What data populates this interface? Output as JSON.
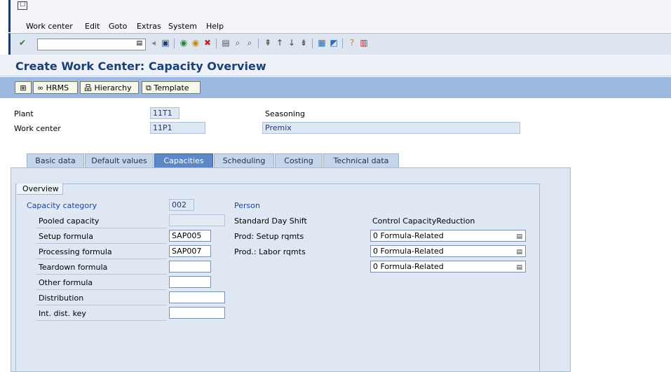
{
  "menu": {
    "items": [
      "Work center",
      "Edit",
      "Goto",
      "Extras",
      "System",
      "Help"
    ]
  },
  "toolbar": {
    "command_value": "",
    "icons": [
      "enter-icon",
      "save-icon",
      "back-icon",
      "exit-icon",
      "cancel-icon",
      "print-icon",
      "find-icon",
      "find-next-icon",
      "first-page-icon",
      "prev-page-icon",
      "next-page-icon",
      "last-page-icon",
      "create-session-icon",
      "shortcut-icon",
      "help-icon",
      "customize-layout-icon"
    ]
  },
  "title": "Create Work Center: Capacity Overview",
  "app_toolbar": {
    "hrms": "HRMS",
    "hierarchy": "Hierarchy",
    "template": "Template"
  },
  "header": {
    "plant_label": "Plant",
    "plant_value": "11T1",
    "plant_desc": "Seasoning",
    "work_center_label": "Work center",
    "work_center_value": "11P1",
    "work_center_desc": "Premix"
  },
  "tabs": [
    "Basic data",
    "Default values",
    "Capacities",
    "Scheduling",
    "Costing",
    "Technical data"
  ],
  "active_tab": "Capacities",
  "overview": {
    "group_title": "Overview",
    "capacity_category_label": "Capacity category",
    "capacity_category_value": "002",
    "capacity_category_desc": "Person",
    "rows": [
      {
        "label": "Pooled capacity",
        "value": ""
      },
      {
        "label": "Setup formula",
        "value": "SAP005"
      },
      {
        "label": "Processing formula",
        "value": "SAP007"
      },
      {
        "label": "Teardown formula",
        "value": ""
      },
      {
        "label": "Other formula",
        "value": ""
      },
      {
        "label": "Distribution",
        "value": ""
      },
      {
        "label": "Int. dist. key",
        "value": ""
      }
    ],
    "standard_day_shift": "Standard Day Shift",
    "prod_setup_rqmts": "Prod: Setup rqmts",
    "prod_labor_rqmts": "Prod.: Labor rqmts",
    "control_header": "Control CapacityReduction",
    "dropdowns": [
      "0 Formula-Related",
      "0 Formula-Related",
      "0 Formula-Related"
    ]
  },
  "colors": {
    "title": "#1b3f78",
    "app_toolbar": "#9db9e2",
    "tab_active": "#5d87c7",
    "tab_inactive": "#c7d5ea"
  }
}
